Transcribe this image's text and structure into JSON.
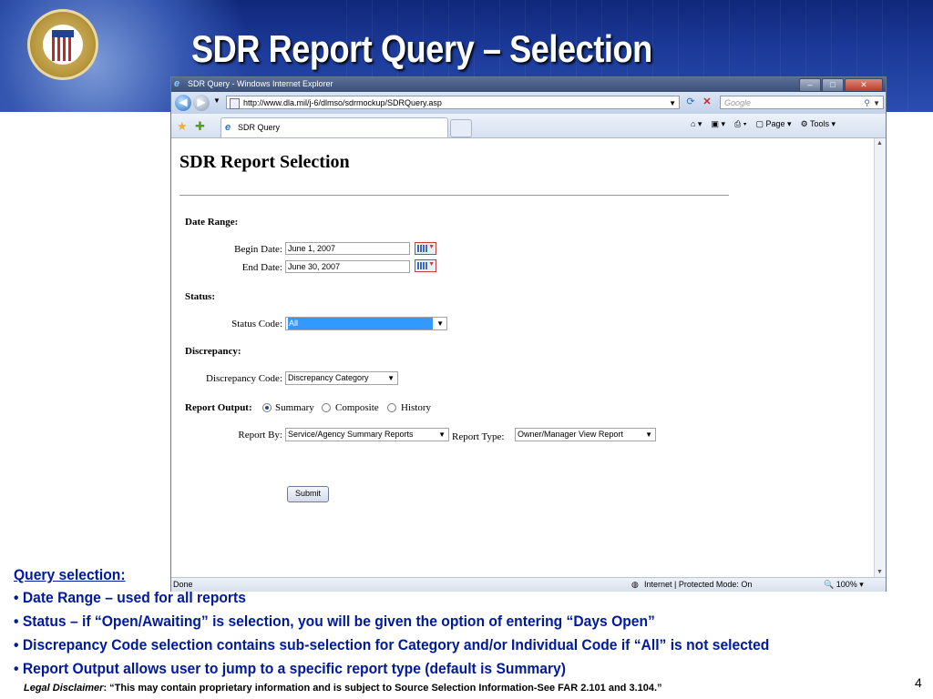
{
  "slide": {
    "title": "SDR Report Query – Selection",
    "page_number": "4",
    "disclaimer_label": "Legal Disclaimer",
    "disclaimer_text": ": “This may contain proprietary information and is subject to Source Selection Information-See FAR 2.101 and 3.104.”"
  },
  "browser": {
    "window_title": "SDR Query - Windows Internet Explorer",
    "url": "http://www.dla.mil/j-6/dlmso/sdrmockup/SDRQuery.asp",
    "search_placeholder": "Google",
    "tab_title": "SDR Query",
    "toolbar": {
      "page": "Page",
      "tools": "Tools"
    },
    "status_left": "Done",
    "status_zone": "Internet | Protected Mode: On",
    "zoom": "100%"
  },
  "form": {
    "heading": "SDR Report Selection",
    "date_range": {
      "label": "Date Range:",
      "begin_label": "Begin Date:",
      "begin_value": "June 1, 2007",
      "end_label": "End Date:",
      "end_value": "June 30, 2007"
    },
    "status": {
      "label": "Status:",
      "code_label": "Status Code:",
      "code_value": "All"
    },
    "discrepancy": {
      "label": "Discrepancy:",
      "code_label": "Discrepancy Code:",
      "code_value": "Discrepancy Category"
    },
    "report_output": {
      "label": "Report Output:",
      "options": [
        "Summary",
        "Composite",
        "History"
      ],
      "selected": "Summary"
    },
    "report_by": {
      "label": "Report By:",
      "value": "Service/Agency Summary Reports"
    },
    "report_type": {
      "label": "Report Type:",
      "value": "Owner/Manager View Report"
    },
    "submit_label": "Submit"
  },
  "notes": {
    "heading": "Query selection:",
    "bullets": [
      "• Date Range – used for all reports",
      "• Status – if “Open/Awaiting” is selection, you will be given the option of entering “Days Open”",
      "• Discrepancy Code selection contains sub-selection for Category and/or Individual Code if “All” is not selected",
      "• Report Output allows user to jump to a specific report type (default is Summary)"
    ]
  },
  "colors": {
    "banner": "#1c3a9a",
    "notes_text": "#001a9a",
    "selection_highlight": "#3399ff"
  }
}
